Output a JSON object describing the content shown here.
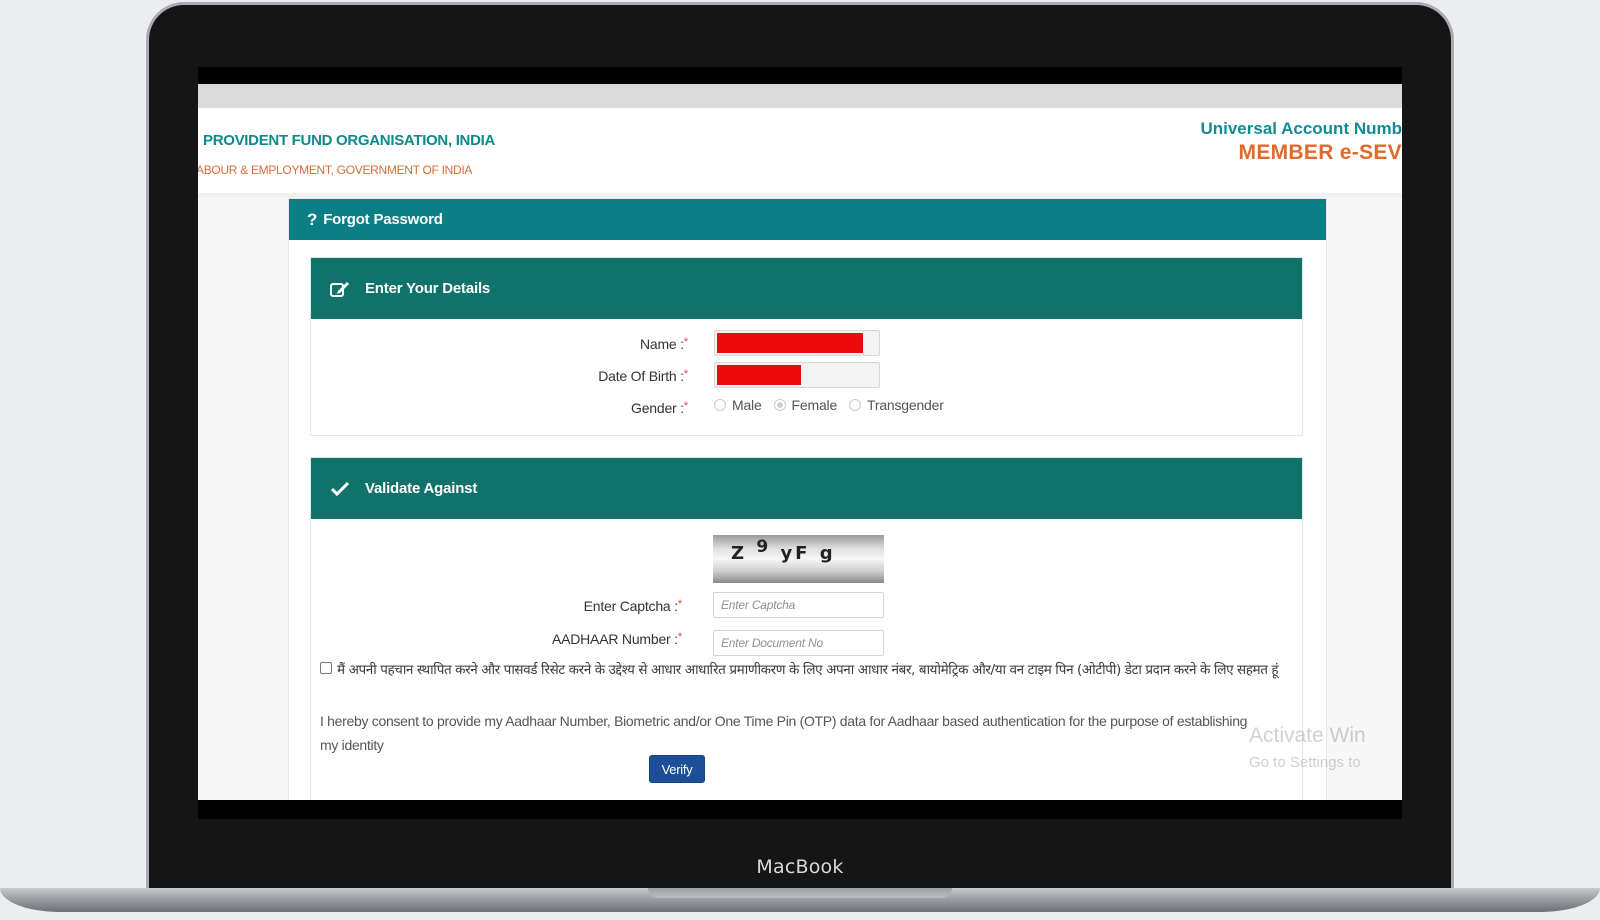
{
  "device": {
    "label": "MacBook"
  },
  "header": {
    "org_name": "PROVIDENT FUND ORGANISATION, INDIA",
    "org_sub": "ABOUR & EMPLOYMENT, GOVERNMENT OF INDIA",
    "uan_title": "Universal Account Numb",
    "member_title": "MEMBER e-SEV"
  },
  "panel": {
    "title": "Forgot Password",
    "icon": "question-icon"
  },
  "details": {
    "title": "Enter Your Details",
    "icon": "edit-icon",
    "name_label": "Name :",
    "dob_label": "Date Of Birth :",
    "gender_label": "Gender :",
    "required_mark": "*",
    "gender_options": [
      "Male",
      "Female",
      "Transgender"
    ],
    "gender_selected": "Female"
  },
  "validate": {
    "title": "Validate Against",
    "icon": "check-icon",
    "captcha_image_text": "Z 9 yF g",
    "captcha_label": "Enter Captcha :",
    "captcha_placeholder": "Enter Captcha",
    "aadhaar_label": "AADHAAR Number :",
    "aadhaar_placeholder": "Enter Document No",
    "consent_hindi": "मैं अपनी पहचान स्थापित करने और पासवर्ड रिसेट करने के उद्देश्य से आधार आधारित प्रमाणीकरण के लिए अपना आधार नंबर, बायोमेट्रिक और/या वन टाइम पिन (ओटीपी) डेटा प्रदान करने के लिए सहमत हूं",
    "consent_english": "I hereby consent to provide my Aadhaar Number, Biometric and/or One Time Pin (OTP) data for Aadhaar based authentication for the purpose of establishing my identity",
    "verify_label": "Verify"
  },
  "watermark": {
    "line1": "Activate Win",
    "line2": "Go to Settings to"
  },
  "colors": {
    "panel_header": "#0b7f86",
    "section_header": "#11726b",
    "org_teal": "#0f8a8a",
    "member_orange": "#e0692c",
    "verify_blue": "#1c4f97",
    "redaction_red": "#ee0a0a"
  }
}
